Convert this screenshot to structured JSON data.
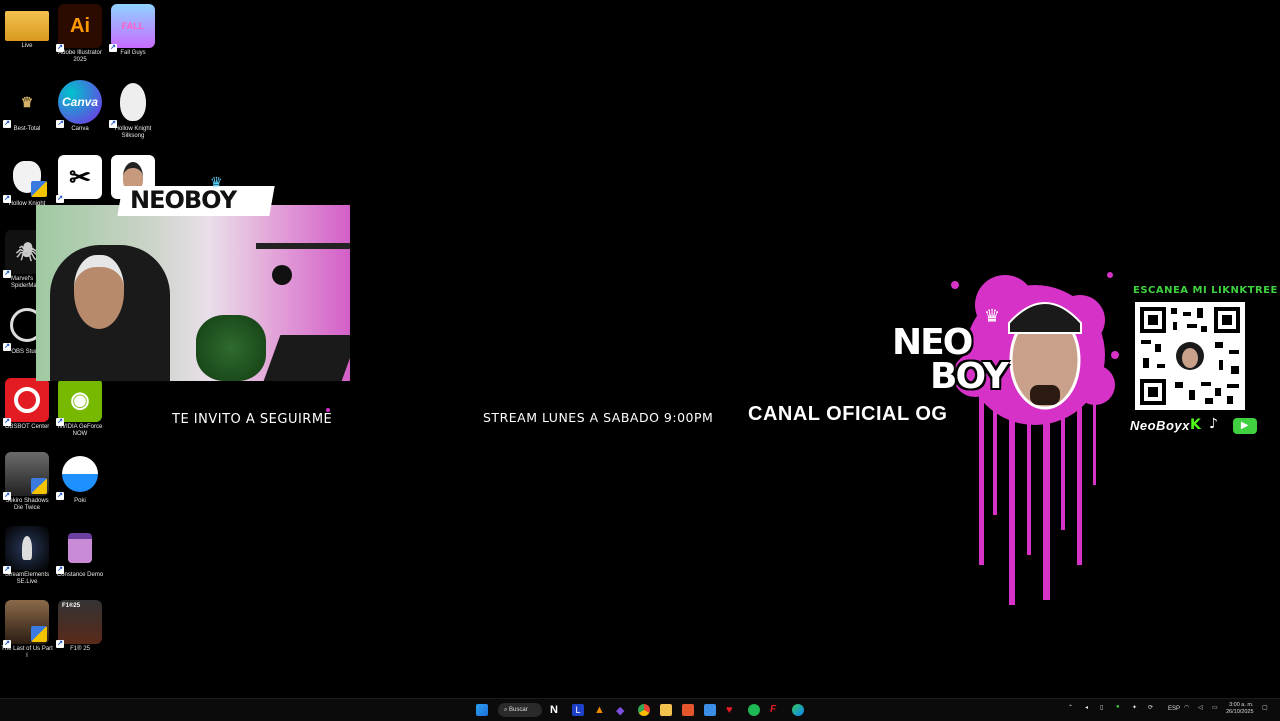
{
  "desktop": {
    "icons": [
      {
        "label": "Live",
        "kind": "folder"
      },
      {
        "label": "Adobe Illustrator 2025",
        "kind": "ai"
      },
      {
        "label": "Fall Guys",
        "kind": "fallguys"
      },
      {
        "label": "Best-Total",
        "kind": "besttotal"
      },
      {
        "label": "Canva",
        "kind": "canva"
      },
      {
        "label": "Hollow Knight Silksong",
        "kind": "hollow"
      },
      {
        "label": "Hollow Knight",
        "kind": "hollowk"
      },
      {
        "label": "",
        "kind": "capcut"
      },
      {
        "label": "",
        "kind": "photo"
      },
      {
        "label": "Marvel's SpiderMan",
        "kind": "spider"
      },
      {
        "label": "OBS Studio",
        "kind": "obs"
      },
      {
        "label": "OBSBOT Center",
        "kind": "obsbot"
      },
      {
        "label": "NVIDIA GeForce NOW",
        "kind": "nvidia"
      },
      {
        "label": "Sekiro Shadows Die Twice",
        "kind": "sekiro"
      },
      {
        "label": "Poki",
        "kind": "poki"
      },
      {
        "label": "StreamElements SE.Live",
        "kind": "se"
      },
      {
        "label": "Constance Demo",
        "kind": "constance"
      },
      {
        "label": "The Last of Us Part I",
        "kind": "tlou"
      },
      {
        "label": "F1® 25",
        "kind": "f1"
      }
    ]
  },
  "overlay": {
    "cam_title": "NEOBOY",
    "follow_text": "TE INVITO A SEGUIRME",
    "schedule_text": "STREAM LUNES A SABADO 9:00PM",
    "channel_text": "CANAL OFICIAL OG",
    "logo_line1": "NEO",
    "logo_line2": "BOY",
    "qr_caption": "ESCANEA MI  LIKNKTREE",
    "handle": "NeoBoyx"
  },
  "taskbar": {
    "search_label": "Buscar",
    "lang": "ESP",
    "time": "3:00 a. m.",
    "date": "26/10/2025"
  },
  "colors": {
    "accent_pink": "#d632c8",
    "qr_green": "#3fd13f",
    "background": "#000000"
  }
}
